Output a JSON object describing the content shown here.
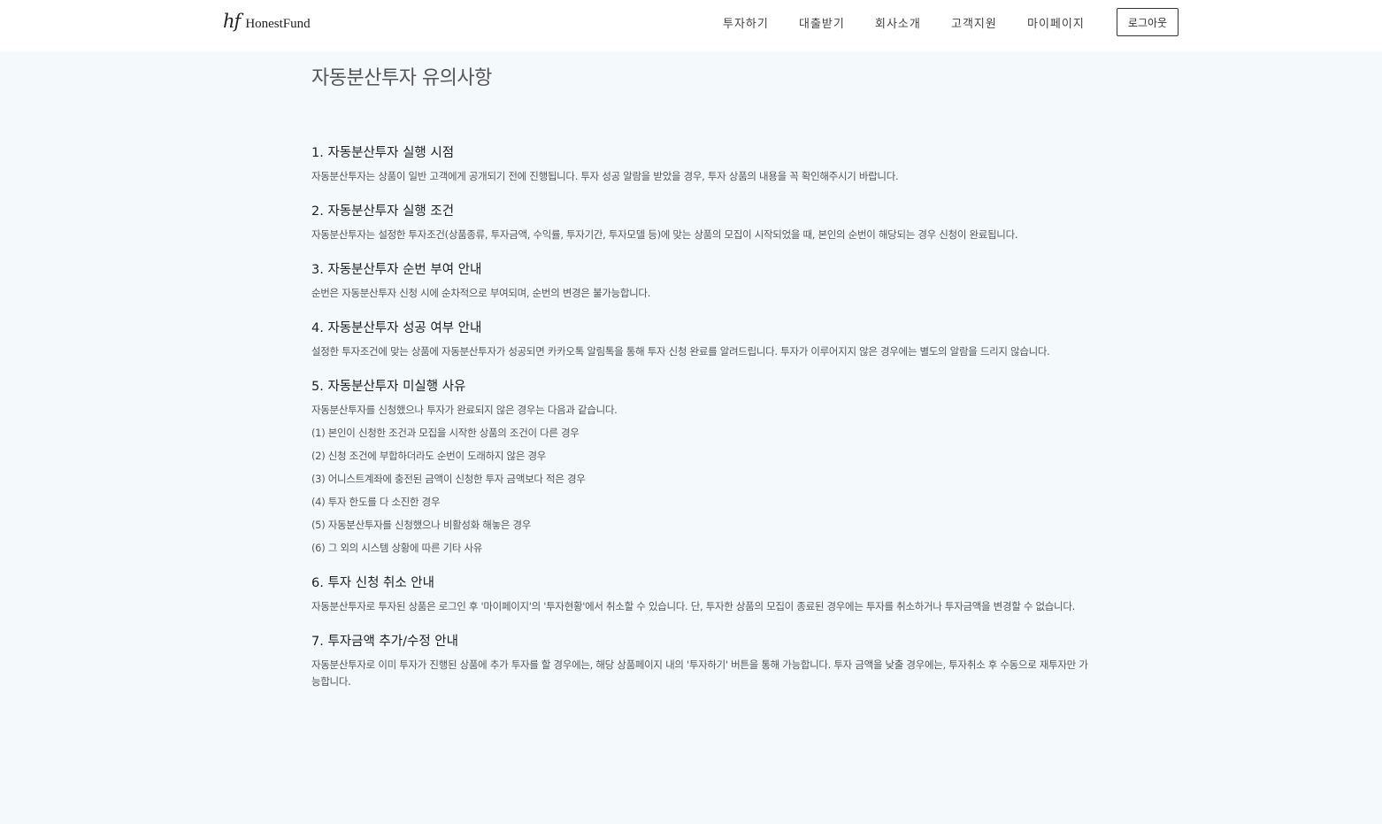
{
  "header": {
    "logo_mark": "hf",
    "logo_text": "HonestFund",
    "nav": [
      "투자하기",
      "대출받기",
      "회사소개",
      "고객지원",
      "마이페이지"
    ],
    "logout_label": "로그아웃"
  },
  "page": {
    "title": "자동분산투자 유의사항",
    "sections": [
      {
        "title": "1. 자동분산투자 실행 시점",
        "body": "자동분산투자는 상품이 일반 고객에게 공개되기 전에 진행됩니다. 투자 성공 알람을 받았을 경우, 투자 상품의 내용을 꼭 확인해주시기 바랍니다."
      },
      {
        "title": "2. 자동분산투자 실행 조건",
        "body": "자동분산투자는 설정한 투자조건(상품종류, 투자금액, 수익률, 투자기간, 투자모델 등)에 맞는 상품의 모집이 시작되었을 때, 본인의 순번이 해당되는 경우 신청이 완료됩니다."
      },
      {
        "title": "3. 자동분산투자 순번 부여 안내",
        "body": "순번은 자동분산투자 신청 시에 순차적으로 부여되며, 순번의 변경은 불가능합니다."
      },
      {
        "title": "4. 자동분산투자 성공 여부 안내",
        "body": "설정한 투자조건에 맞는 상품에 자동분산투자가 성공되면 카카오톡 알림톡을 통해 투자 신청 완료를 알려드립니다. 투자가 이루어지지 않은 경우에는 별도의 알람을 드리지 않습니다."
      },
      {
        "title": "5. 자동분산투자 미실행 사유",
        "body": "자동분산투자를 신청했으나 투자가 완료되지 않은 경우는 다음과 같습니다.",
        "items": [
          "(1) 본인이 신청한 조건과 모집을 시작한 상품의 조건이 다른 경우",
          "(2) 신청 조건에 부합하더라도 순번이 도래하지 않은 경우",
          "(3) 어니스트계좌에 충전된 금액이 신청한 투자 금액보다 적은 경우",
          "(4) 투자 한도를 다 소진한 경우",
          "(5) 자동분산투자를 신청했으나 비활성화 해놓은 경우",
          "(6) 그 외의 시스템 상황에 따른 기타 사유"
        ]
      },
      {
        "title": "6. 투자 신청 취소 안내",
        "body": "자동분산투자로 투자된 상품은 로그인 후 '마이페이지'의 '투자현황'에서 취소할 수 있습니다. 단, 투자한 상품의 모집이 종료된 경우에는 투자를 취소하거나 투자금액을 변경할 수 없습니다."
      },
      {
        "title": "7. 투자금액 추가/수정 안내",
        "body": "자동분산투자로 이미 투자가 진행된 상품에 추가 투자를 할 경우에는, 해당 상품페이지 내의 '투자하기' 버튼을 통해 가능합니다. 투자 금액을 낮출 경우에는, 투자취소 후 수동으로 재투자만 가능합니다."
      }
    ]
  }
}
